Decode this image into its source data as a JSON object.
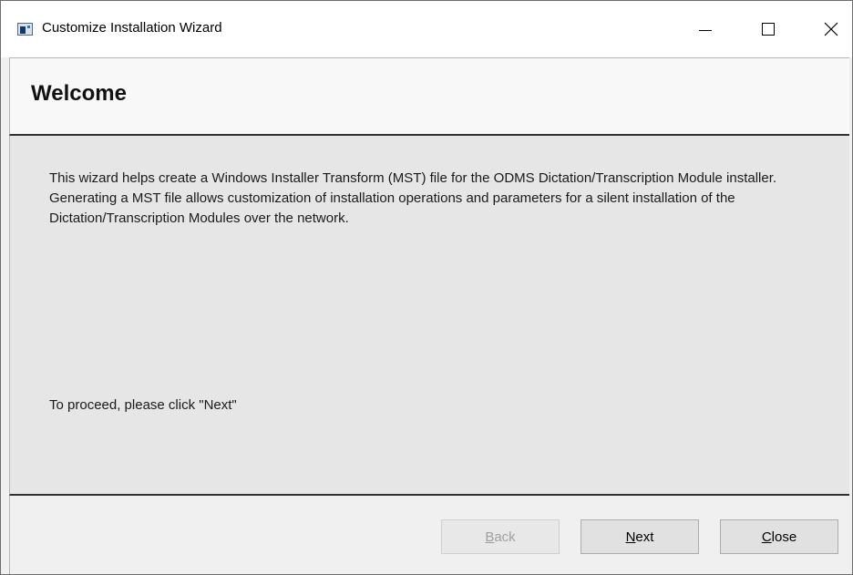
{
  "window": {
    "title": "Customize Installation Wizard",
    "controls": {
      "minimize": "minimize",
      "maximize": "maximize",
      "close": "close"
    }
  },
  "header": {
    "title": "Welcome"
  },
  "content": {
    "paragraph_1": "This wizard helps create a Windows Installer Transform (MST) file for the ODMS Dictation/Transcription Module installer.",
    "paragraph_2": "Generating a MST file allows customization of installation operations and parameters for a silent installation of the Dictation/Transcription Modules over the network.",
    "proceed_text": "To proceed, please click \"Next\""
  },
  "footer": {
    "back": {
      "access_key": "B",
      "rest": "ack",
      "enabled": false
    },
    "next": {
      "access_key": "N",
      "rest": "ext",
      "enabled": true
    },
    "close": {
      "access_key": "C",
      "rest": "lose",
      "enabled": true
    }
  },
  "icons": {
    "app": "app-window-icon",
    "minimize": "minimize-icon",
    "maximize": "maximize-icon",
    "close": "close-icon"
  }
}
